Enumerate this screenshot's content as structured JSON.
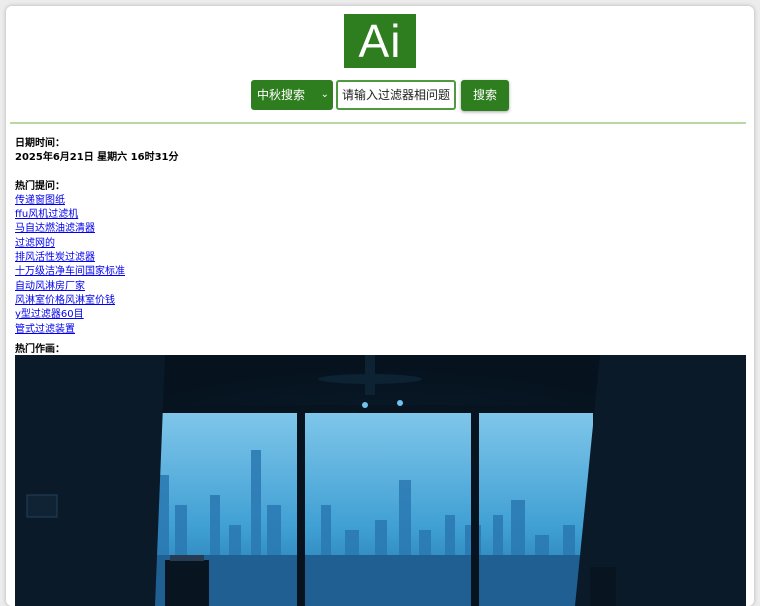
{
  "logo": {
    "text": "Ai"
  },
  "search": {
    "engine_selected": "中秋搜索",
    "query_value": "请输入过滤器相问题",
    "button_label": "搜索"
  },
  "datetime": {
    "label": "日期时间：",
    "value": "2025年6月21日 星期六 16时31分"
  },
  "hot_questions": {
    "label": "热门提问：",
    "items": [
      "传递窗图纸",
      "ffu风机过滤机",
      "马自达燃油滤清器",
      "过滤网的",
      "排风活性炭过滤器",
      "十万级洁净车间国家标准",
      "自动风淋房厂家",
      "风淋室价格风淋室价钱",
      "y型过滤器60目",
      "管式过滤装置"
    ]
  },
  "hot_artwork": {
    "label": "热门作画："
  },
  "colors": {
    "brand_green": "#2e7d1e",
    "link": "#0000ee",
    "divider": "#b9d6a5"
  }
}
